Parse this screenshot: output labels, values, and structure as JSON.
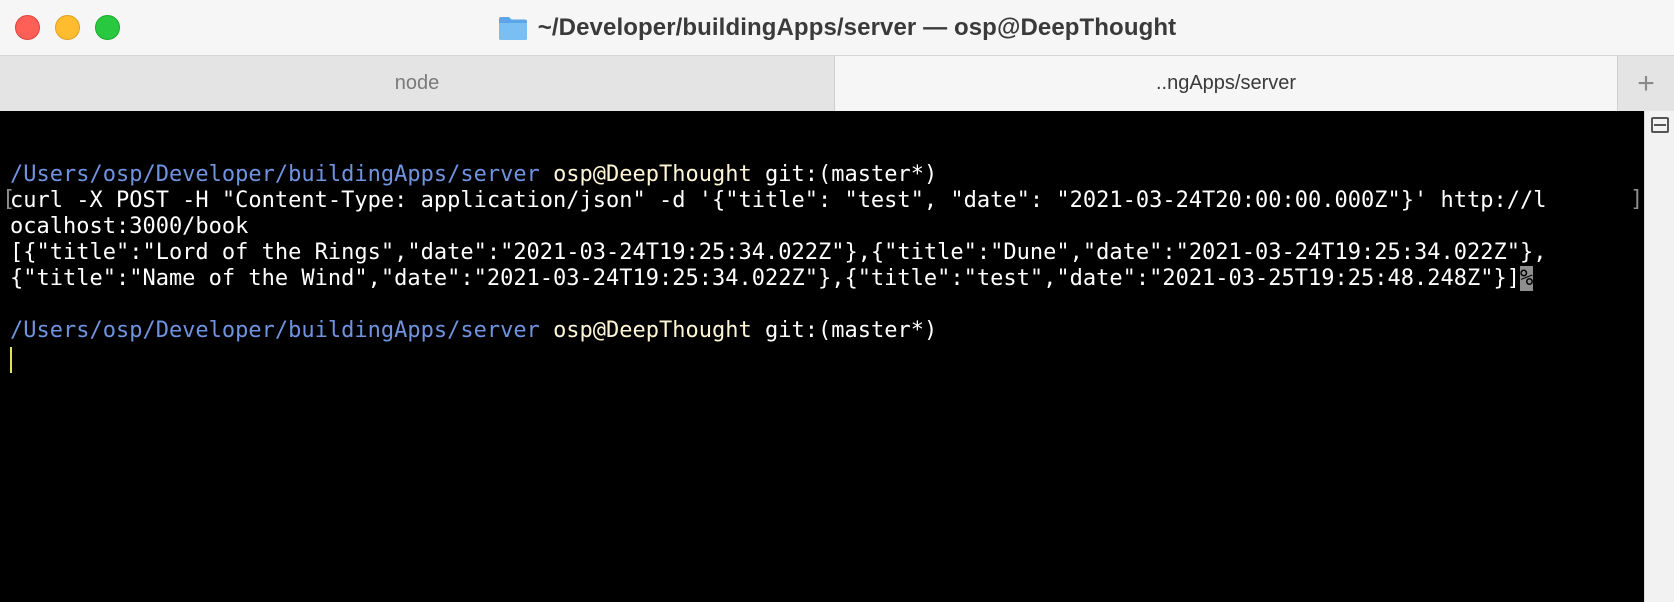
{
  "window": {
    "title": "~/Developer/buildingApps/server — osp@DeepThought"
  },
  "tabs": [
    {
      "label": "node"
    },
    {
      "label": "..ngApps/server"
    }
  ],
  "tab_add_label": "+",
  "terminal": {
    "prompt1": {
      "path": "/Users/osp/Developer/buildingApps/server",
      "userhost": "osp@DeepThought",
      "git": "git:(master*)"
    },
    "command_line1": "curl -X POST -H \"Content-Type: application/json\" -d '{\"title\": \"test\", \"date\": \"2021-03-24T20:00:00.000Z\"}' http://l",
    "command_line2": "ocalhost:3000/book",
    "output_line1": "[{\"title\":\"Lord of the Rings\",\"date\":\"2021-03-24T19:25:34.022Z\"},{\"title\":\"Dune\",\"date\":\"2021-03-24T19:25:34.022Z\"},",
    "output_line2": "{\"title\":\"Name of the Wind\",\"date\":\"2021-03-24T19:25:34.022Z\"},{\"title\":\"test\",\"date\":\"2021-03-25T19:25:48.248Z\"}]",
    "end_marker": "%",
    "prompt2": {
      "path": "/Users/osp/Developer/buildingApps/server",
      "userhost": "osp@DeepThought",
      "git": "git:(master*)"
    }
  },
  "icons": {
    "folder": "folder-icon",
    "split": "split-pane-icon"
  },
  "colors": {
    "close": "#fe5f57",
    "minimize": "#febc2e",
    "zoom": "#28c840",
    "path": "#6f93df",
    "userhost": "#fff6d6",
    "background": "#000000"
  }
}
